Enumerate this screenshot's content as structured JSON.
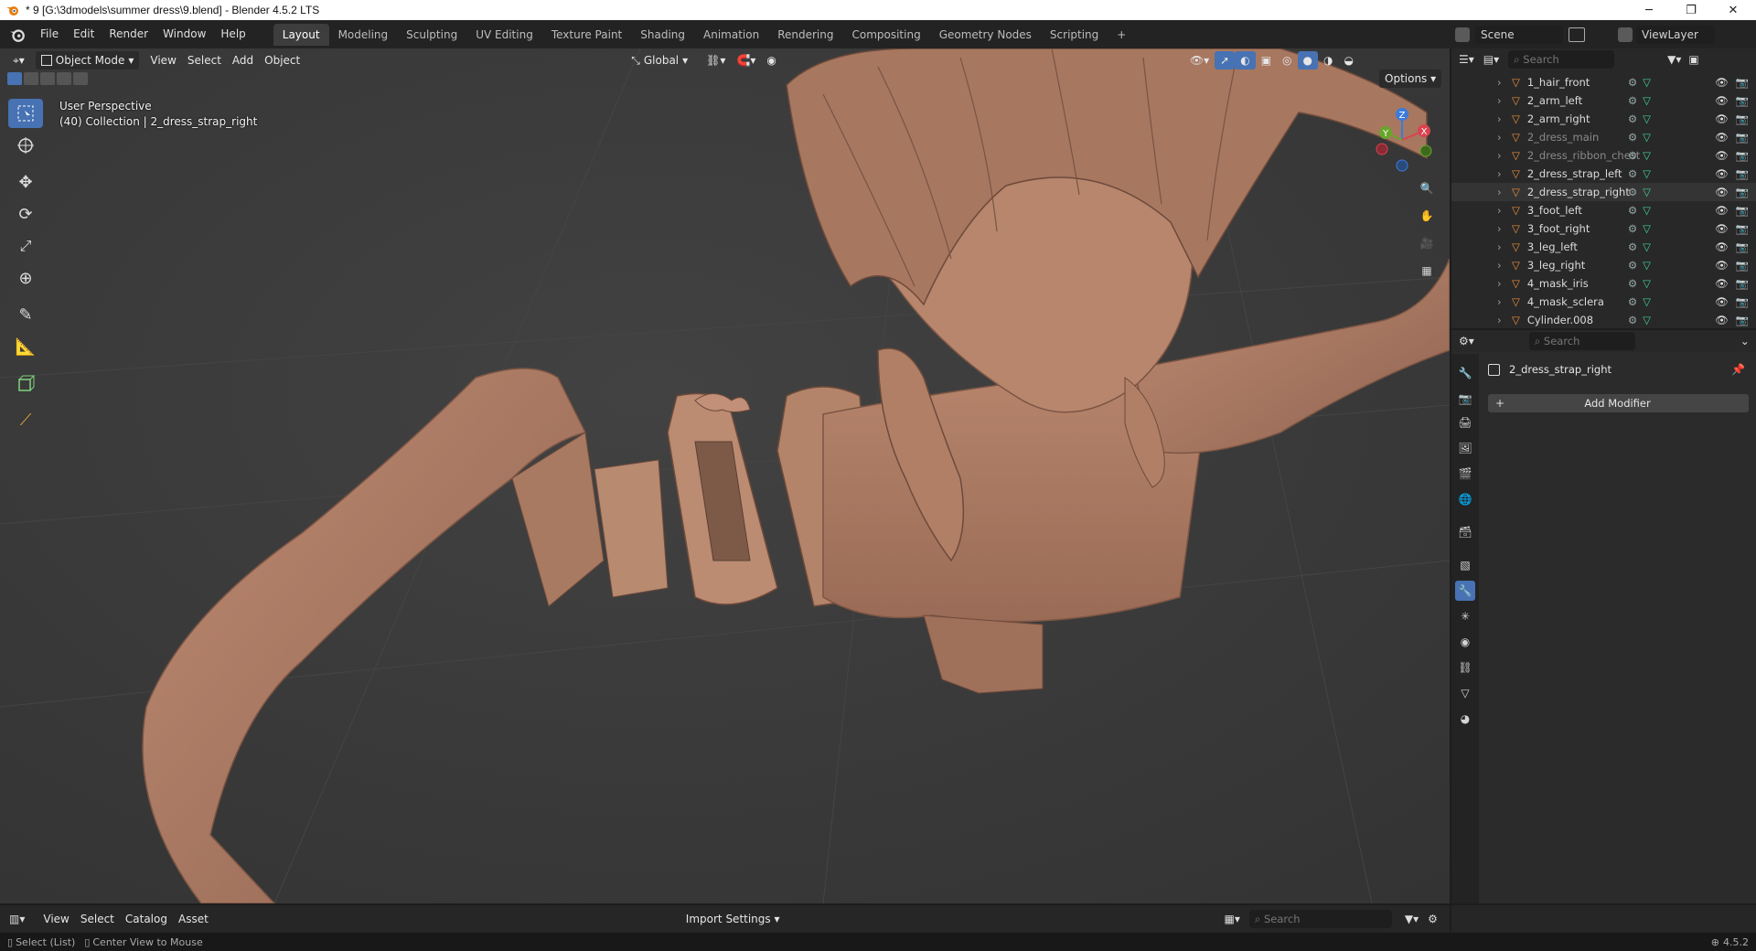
{
  "window": {
    "title": "* 9 [G:\\3dmodels\\summer dress\\9.blend] - Blender 4.5.2 LTS",
    "minimize": "─",
    "maximize": "❐",
    "close": "✕"
  },
  "menu": [
    "File",
    "Edit",
    "Render",
    "Window",
    "Help"
  ],
  "workspaces": {
    "tabs": [
      "Layout",
      "Modeling",
      "Sculpting",
      "UV Editing",
      "Texture Paint",
      "Shading",
      "Animation",
      "Rendering",
      "Compositing",
      "Geometry Nodes",
      "Scripting"
    ],
    "active": "Layout",
    "add": "+"
  },
  "scene": {
    "label": "Scene",
    "viewlayer": "ViewLayer"
  },
  "viewport": {
    "mode": "Object Mode",
    "menus": [
      "View",
      "Select",
      "Add",
      "Object"
    ],
    "orientation": "Global",
    "options_label": "Options",
    "overlay_line1": "User Perspective",
    "overlay_line2": "(40) Collection | 2_dress_strap_right",
    "gizmo": {
      "x": "X",
      "y": "Y",
      "z": "Z"
    }
  },
  "outliner": {
    "search_placeholder": "Search",
    "rows": [
      {
        "name": "1_hair_front",
        "dim": false
      },
      {
        "name": "2_arm_left",
        "dim": false
      },
      {
        "name": "2_arm_right",
        "dim": false
      },
      {
        "name": "2_dress_main",
        "dim": true
      },
      {
        "name": "2_dress_ribbon_chest",
        "dim": true
      },
      {
        "name": "2_dress_strap_left",
        "dim": false
      },
      {
        "name": "2_dress_strap_right",
        "dim": false,
        "selected": true
      },
      {
        "name": "3_foot_left",
        "dim": false
      },
      {
        "name": "3_foot_right",
        "dim": false
      },
      {
        "name": "3_leg_left",
        "dim": false
      },
      {
        "name": "3_leg_right",
        "dim": false
      },
      {
        "name": "4_mask_iris",
        "dim": false
      },
      {
        "name": "4_mask_sclera",
        "dim": false
      },
      {
        "name": "Cylinder.008",
        "dim": false
      }
    ]
  },
  "properties": {
    "search_placeholder": "Search",
    "object_name": "2_dress_strap_right",
    "add_modifier": "Add Modifier"
  },
  "assetbar": {
    "menus": [
      "View",
      "Select",
      "Catalog",
      "Asset"
    ],
    "import_settings": "Import Settings",
    "search_placeholder": "Search"
  },
  "status": {
    "left1": "Select (List)",
    "left2": "Center View to Mouse",
    "version": "4.5.2"
  },
  "colors": {
    "accent": "#4772b3",
    "model": "#b08068",
    "viewport_bg": "#3a3a3a"
  }
}
